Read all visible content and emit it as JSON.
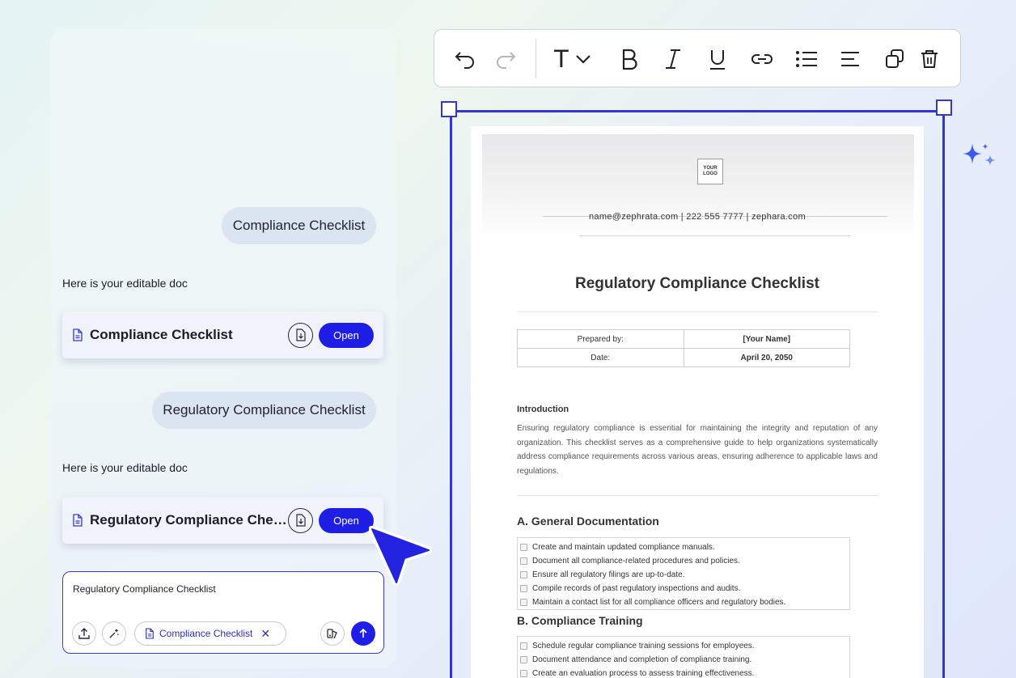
{
  "chat": {
    "messages": [
      {
        "role": "user",
        "text": "Compliance Checklist"
      },
      {
        "role": "bot",
        "text": "Here is your editable doc"
      },
      {
        "role": "user",
        "text": "Regulatory Compliance Checklist"
      },
      {
        "role": "bot",
        "text": "Here is your editable doc"
      }
    ],
    "cards": [
      {
        "title": "Compliance Checklist",
        "open_label": "Open"
      },
      {
        "title": "Regulatory Compliance Checklist",
        "open_label": "Open"
      }
    ],
    "composer": {
      "text": "Regulatory Compliance Checklist",
      "chip_label": "Compliance Checklist",
      "chip_close": "✕"
    }
  },
  "toolbar": {
    "text_glyph": "T"
  },
  "document": {
    "logo_text": "YOUR LOGO",
    "contact": "name@zephrata.com | 222 555 7777 | zephara.com",
    "title": "Regulatory Compliance Checklist",
    "meta": [
      {
        "label": "Prepared by:",
        "value": "[Your Name]"
      },
      {
        "label": "Date:",
        "value": "April 20, 2050"
      }
    ],
    "intro_heading": "Introduction",
    "intro_body": "Ensuring regulatory compliance is essential for maintaining the integrity and reputation of any organization. This checklist serves as a comprehensive guide to help organizations systematically address compliance requirements across various areas, ensuring adherence to applicable laws and regulations.",
    "sections": [
      {
        "title": "A. General Documentation",
        "items": [
          "Create and maintain updated compliance manuals.",
          "Document all compliance-related procedures and policies.",
          "Ensure all regulatory filings are up-to-date.",
          "Compile records of past regulatory inspections and audits.",
          "Maintain a contact list for all compliance officers and regulatory bodies."
        ]
      },
      {
        "title": "B. Compliance Training",
        "items": [
          "Schedule regular compliance training sessions for employees.",
          "Document attendance and completion of compliance training.",
          "Create an evaluation process to assess training effectiveness."
        ]
      }
    ]
  },
  "colors": {
    "accent": "#1f1ee6",
    "selection": "#3535d0"
  }
}
